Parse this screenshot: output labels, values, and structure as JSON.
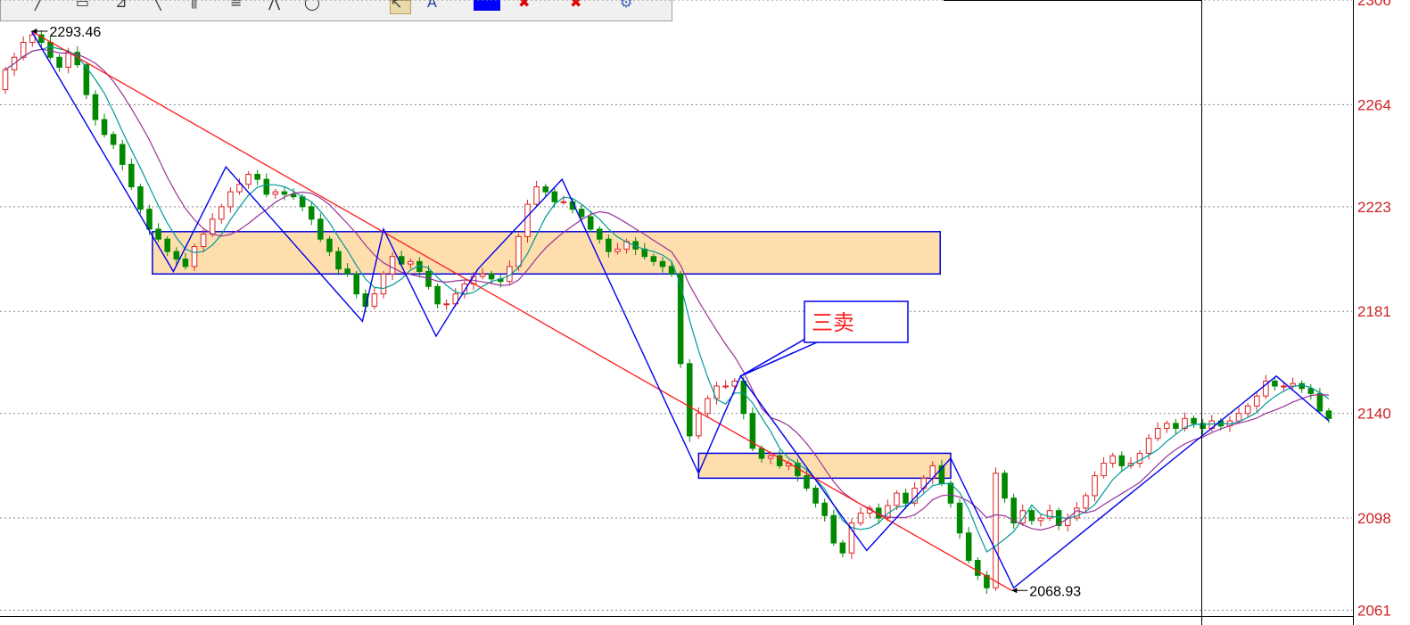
{
  "colors": {
    "up_candle": "#dd2222",
    "down_candle": "#008800",
    "ma_fast": "#009a9a",
    "ma_slow": "#993399",
    "zigzag": "#0000ee",
    "trendline": "#ff1a1a",
    "zone_fill": "#ffdead",
    "zone_border": "#0000dd",
    "price_label": "#cc2222",
    "grid": "#888888"
  },
  "toolbar": {
    "icons": [
      "pen-icon",
      "rectangle-icon",
      "fib-fan-icon",
      "line-tool-icon",
      "vertical-lines-icon",
      "horizontal-lines-icon",
      "polyline-icon",
      "ellipse-icon",
      "cursor-icon",
      "text-tool-icon",
      "color-swatch-icon",
      "delete-icon",
      "delete-all-icon",
      "settings-icon"
    ],
    "color_swatch": "#0000ff"
  },
  "chart_data": {
    "type": "candlestick",
    "y_axis": {
      "ticks": [
        2306,
        2264,
        2223,
        2181,
        2140,
        2098,
        2061
      ],
      "ylim": [
        2059,
        2306
      ],
      "position": "right",
      "grid": true
    },
    "x_range": [
      0,
      126
    ],
    "extremes": [
      {
        "label": "2293.46",
        "x": 2.5,
        "y": 2293.46
      },
      {
        "label": "2068.93",
        "x": 95.8,
        "y": 2068.93
      }
    ],
    "callout": {
      "text": "三卖",
      "pointer_x": 70.0,
      "pointer_y": 2155
    },
    "zones": [
      {
        "x0": 14,
        "x1": 89,
        "y_top": 2213,
        "y_bottom": 2196
      },
      {
        "x0": 66,
        "x1": 90,
        "y_top": 2124,
        "y_bottom": 2114
      }
    ],
    "trendline": {
      "x0": 2.5,
      "y0": 2293.46,
      "x1": 95.8,
      "y1": 2068.93
    },
    "zigzag": {
      "x": [
        2.5,
        16,
        21,
        34,
        36,
        41,
        45,
        53,
        66,
        70,
        82,
        90,
        96,
        121,
        126
      ],
      "y": [
        2293.46,
        2197,
        2239,
        2177,
        2214,
        2171,
        2198,
        2234,
        2116,
        2155,
        2085,
        2122,
        2070,
        2155,
        2137
      ]
    },
    "candles": {
      "open": [
        2270,
        2278,
        2283,
        2289,
        2292,
        2289,
        2283,
        2279,
        2285,
        2280,
        2268,
        2258,
        2252,
        2248,
        2240,
        2231,
        2222,
        2214,
        2210,
        2205,
        2202,
        2199,
        2207,
        2212,
        2218,
        2223,
        2229,
        2232,
        2236,
        2234,
        2228,
        2229,
        2228,
        2227,
        2223,
        2218,
        2210,
        2205,
        2198,
        2196,
        2188,
        2183,
        2188,
        2196,
        2203,
        2200,
        2201,
        2197,
        2191,
        2184,
        2184,
        2188,
        2192,
        2195,
        2196,
        2194,
        2193,
        2199,
        2211,
        2224,
        2231,
        2229,
        2225,
        2225,
        2222,
        2219,
        2214,
        2210,
        2205,
        2206,
        2209,
        2206,
        2203,
        2201,
        2199,
        2196,
        2160,
        2131,
        2140,
        2146,
        2151,
        2151,
        2153,
        2140,
        2126,
        2122,
        2123,
        2119,
        2120,
        2115,
        2110,
        2104,
        2099,
        2088,
        2084,
        2096,
        2100,
        2102,
        2098,
        2103,
        2108,
        2104,
        2110,
        2114,
        2119,
        2112,
        2104,
        2092,
        2081,
        2075,
        2070,
        2116,
        2106,
        2096,
        2101,
        2097,
        2098,
        2101,
        2095,
        2098,
        2102,
        2107,
        2115,
        2120,
        2123,
        2119,
        2120,
        2124,
        2130,
        2134,
        2136,
        2134,
        2138,
        2136,
        2134,
        2137,
        2135,
        2137,
        2140,
        2143,
        2147,
        2153,
        2151,
        2151,
        2152,
        2150,
        2148,
        2141
      ],
      "close": [
        2278,
        2283,
        2289,
        2292,
        2289,
        2283,
        2279,
        2285,
        2280,
        2268,
        2258,
        2252,
        2248,
        2240,
        2231,
        2222,
        2214,
        2210,
        2205,
        2202,
        2199,
        2207,
        2212,
        2218,
        2223,
        2229,
        2232,
        2236,
        2234,
        2228,
        2229,
        2228,
        2227,
        2223,
        2218,
        2210,
        2205,
        2198,
        2196,
        2188,
        2183,
        2188,
        2196,
        2203,
        2200,
        2201,
        2197,
        2191,
        2184,
        2184,
        2188,
        2192,
        2195,
        2196,
        2194,
        2193,
        2199,
        2211,
        2224,
        2231,
        2229,
        2225,
        2225,
        2222,
        2219,
        2214,
        2210,
        2205,
        2206,
        2209,
        2206,
        2203,
        2201,
        2199,
        2196,
        2160,
        2131,
        2140,
        2146,
        2151,
        2151,
        2153,
        2140,
        2126,
        2122,
        2123,
        2119,
        2120,
        2115,
        2110,
        2104,
        2099,
        2088,
        2084,
        2096,
        2100,
        2102,
        2098,
        2103,
        2108,
        2104,
        2110,
        2114,
        2119,
        2112,
        2104,
        2092,
        2081,
        2075,
        2070,
        2116,
        2106,
        2096,
        2101,
        2097,
        2098,
        2101,
        2095,
        2098,
        2102,
        2107,
        2115,
        2120,
        2123,
        2119,
        2120,
        2124,
        2130,
        2134,
        2136,
        2134,
        2138,
        2136,
        2134,
        2137,
        2135,
        2137,
        2140,
        2143,
        2147,
        2153,
        2151,
        2151,
        2152,
        2150,
        2148,
        2141,
        2138
      ]
    },
    "ma_fast_window": 5,
    "ma_slow_window": 10
  }
}
